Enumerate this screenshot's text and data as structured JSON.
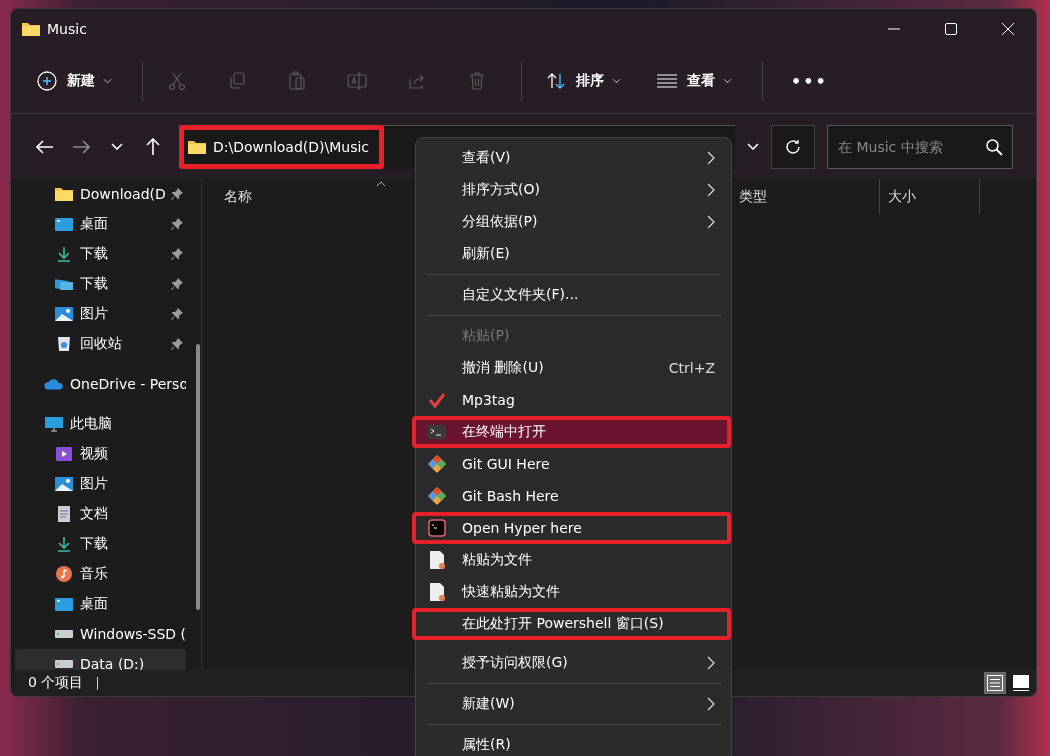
{
  "window": {
    "title": "Music"
  },
  "toolbar": {
    "new_label": "新建",
    "icon_actions": [
      {
        "kind": "cut",
        "disabled": true
      },
      {
        "kind": "copy",
        "disabled": true
      },
      {
        "kind": "paste",
        "disabled": true
      },
      {
        "kind": "rename",
        "disabled": true
      },
      {
        "kind": "share",
        "disabled": true
      },
      {
        "kind": "delete",
        "disabled": true
      }
    ],
    "sort_label": "排序",
    "view_label": "查看",
    "more_label": "•••"
  },
  "navigation": {
    "back_disabled": false,
    "forward_disabled": true
  },
  "address": {
    "path": "D:\\Download(D)\\Music",
    "annotated": true
  },
  "search": {
    "placeholder": "在 Music 中搜索"
  },
  "sidebar": {
    "quick_access": [
      {
        "label": "Download(D",
        "kind": "folder",
        "pinned": true
      },
      {
        "label": "桌面",
        "kind": "desktop",
        "pinned": true
      },
      {
        "label": "下载",
        "kind": "download",
        "pinned": true
      },
      {
        "label": "下载",
        "kind": "network",
        "pinned": true
      },
      {
        "label": "图片",
        "kind": "pictures",
        "pinned": true
      },
      {
        "label": "回收站",
        "kind": "recycle",
        "pinned": true
      }
    ],
    "onedrive": {
      "label": "OneDrive - Perso"
    },
    "this_pc": {
      "label": "此电脑",
      "children": [
        {
          "label": "视频",
          "kind": "video",
          "selected": false
        },
        {
          "label": "图片",
          "kind": "pictures",
          "selected": false
        },
        {
          "label": "文档",
          "kind": "document",
          "selected": false
        },
        {
          "label": "下载",
          "kind": "download",
          "selected": false
        },
        {
          "label": "音乐",
          "kind": "music",
          "selected": false
        },
        {
          "label": "桌面",
          "kind": "desktop",
          "selected": false
        },
        {
          "label": "Windows-SSD (",
          "kind": "drive",
          "selected": false
        },
        {
          "label": "Data (D:)",
          "kind": "drive",
          "selected": true
        }
      ]
    }
  },
  "table": {
    "columns": [
      {
        "label": "名称",
        "sorted": true
      },
      {
        "label": "类型",
        "sorted": false
      },
      {
        "label": "大小",
        "sorted": false
      }
    ]
  },
  "context_menu": {
    "items": [
      {
        "kind": "plain",
        "label": "查看(V)",
        "submenu": true,
        "disabled": false,
        "hovered": false,
        "annotated": false
      },
      {
        "kind": "plain",
        "label": "排序方式(O)",
        "submenu": true,
        "disabled": false,
        "hovered": false,
        "annotated": false
      },
      {
        "kind": "plain",
        "label": "分组依据(P)",
        "submenu": true,
        "disabled": false,
        "hovered": false,
        "annotated": false
      },
      {
        "kind": "plain",
        "label": "刷新(E)",
        "submenu": false,
        "disabled": false,
        "hovered": false,
        "annotated": false
      },
      {
        "kind": "separator"
      },
      {
        "kind": "plain",
        "label": "自定义文件夹(F)...",
        "submenu": false,
        "disabled": false,
        "hovered": false,
        "annotated": false
      },
      {
        "kind": "separator"
      },
      {
        "kind": "plain",
        "label": "粘贴(P)",
        "submenu": false,
        "disabled": true,
        "hovered": false,
        "annotated": false
      },
      {
        "kind": "plain",
        "label": "撤消 删除(U)",
        "shortcut": "Ctrl+Z",
        "submenu": false,
        "disabled": false,
        "hovered": false,
        "annotated": false
      },
      {
        "kind": "check",
        "label": "Mp3tag",
        "submenu": false,
        "disabled": false,
        "hovered": false,
        "annotated": false
      },
      {
        "kind": "terminal",
        "label": "在终端中打开",
        "submenu": false,
        "disabled": false,
        "hovered": true,
        "annotated": true
      },
      {
        "kind": "git",
        "label": "Git GUI Here",
        "submenu": false,
        "disabled": false,
        "hovered": false,
        "annotated": false
      },
      {
        "kind": "git",
        "label": "Git Bash Here",
        "submenu": false,
        "disabled": false,
        "hovered": false,
        "annotated": false
      },
      {
        "kind": "hyper",
        "label": "Open Hyper here",
        "submenu": false,
        "disabled": false,
        "hovered": false,
        "annotated": true
      },
      {
        "kind": "paper",
        "label": "粘贴为文件",
        "submenu": false,
        "disabled": false,
        "hovered": false,
        "annotated": false
      },
      {
        "kind": "paper",
        "label": "快速粘贴为文件",
        "submenu": false,
        "disabled": false,
        "hovered": false,
        "annotated": false
      },
      {
        "kind": "plain",
        "label": "在此处打开 Powershell 窗口(S)",
        "submenu": false,
        "disabled": false,
        "hovered": false,
        "annotated": true
      },
      {
        "kind": "gap"
      },
      {
        "kind": "plain",
        "label": "授予访问权限(G)",
        "submenu": true,
        "disabled": false,
        "hovered": false,
        "annotated": false
      },
      {
        "kind": "separator"
      },
      {
        "kind": "plain",
        "label": "新建(W)",
        "submenu": true,
        "disabled": false,
        "hovered": false,
        "annotated": false
      },
      {
        "kind": "separator"
      },
      {
        "kind": "plain",
        "label": "属性(R)",
        "submenu": false,
        "disabled": false,
        "hovered": false,
        "annotated": false
      }
    ]
  },
  "status_bar": {
    "text": "0 个项目",
    "views": [
      {
        "kind": "details",
        "selected": true
      },
      {
        "kind": "tiles",
        "selected": false
      }
    ]
  }
}
